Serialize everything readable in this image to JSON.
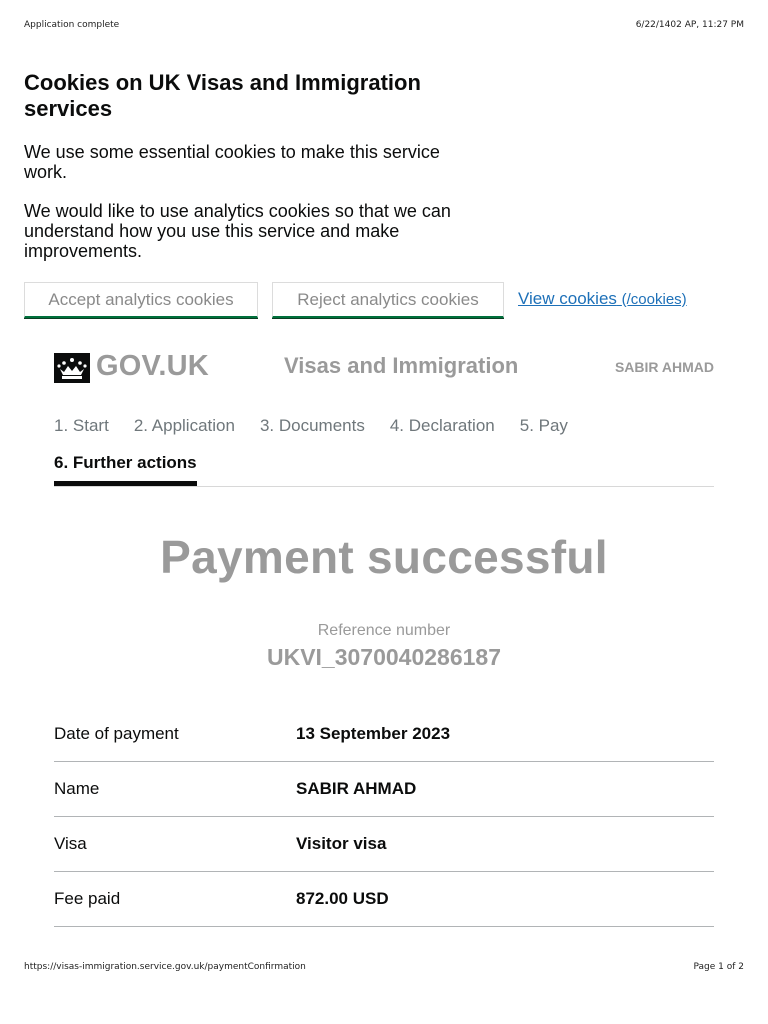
{
  "print": {
    "header_left": "Application complete",
    "header_right": "6/22/1402 AP, 11:27 PM",
    "footer_left": "https://visas-immigration.service.gov.uk/paymentConfirmation",
    "footer_right": "Page 1 of 2"
  },
  "cookie_banner": {
    "title": "Cookies on UK Visas and Immigration services",
    "para1": "We use some essential cookies to make this service work.",
    "para2": "We would like to use analytics cookies so that we can understand how you use this service and make improvements.",
    "accept_label": "Accept analytics cookies",
    "reject_label": "Reject analytics cookies",
    "view_link_label": "View cookies",
    "view_link_href": "(/cookies)"
  },
  "header": {
    "logo_icon": "crown-icon",
    "govuk_text": "GOV.UK",
    "service_name": "Visas and Immigration",
    "user_name": "SABIR AHMAD"
  },
  "steps": {
    "items": [
      {
        "label": "1. Start"
      },
      {
        "label": "2. Application"
      },
      {
        "label": "3. Documents"
      },
      {
        "label": "4. Declaration"
      },
      {
        "label": "5. Pay"
      }
    ],
    "active_label": "6. Further actions"
  },
  "main": {
    "title": "Payment successful",
    "reference_label": "Reference number",
    "reference_value": "UKVI_3070040286187",
    "summary": [
      {
        "key": "Date of payment",
        "value": "13 September 2023"
      },
      {
        "key": "Name",
        "value": "SABIR AHMAD"
      },
      {
        "key": "Visa",
        "value": "Visitor visa"
      },
      {
        "key": "Fee paid",
        "value": "872.00 USD"
      }
    ]
  },
  "colors": {
    "link": "#1d70b8",
    "button_border": "#00703c",
    "muted_text": "#9a9a9a",
    "text": "#0b0c0c"
  }
}
